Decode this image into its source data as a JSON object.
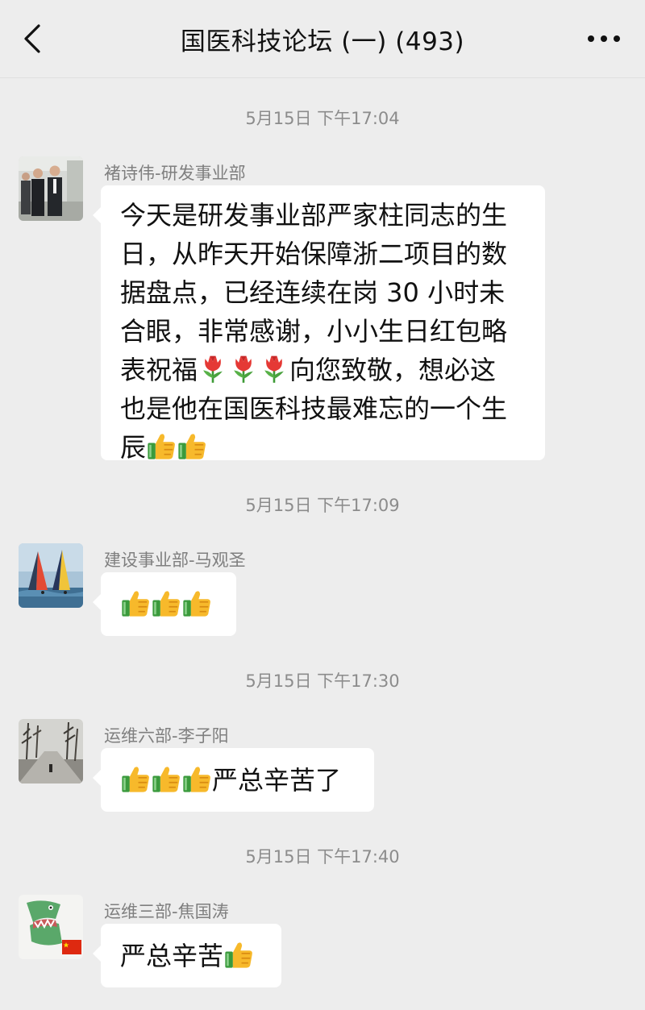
{
  "header": {
    "title": "国医科技论坛 (一) (493)"
  },
  "messages": [
    {
      "time": "5月15日 下午17:04",
      "sender": "褚诗伟-研发事业部",
      "text": "今天是研发事业部严家柱同志的生日，从昨天开始保障浙二项目的数据盘点，已经连续在岗 30 小时未合眼，非常感谢，小小生日红包略表祝福🌷🌷🌷向您致敬，想必这也是他在国医科技最难忘的一个生辰👍👍"
    },
    {
      "time": "5月15日 下午17:09",
      "sender": "建设事业部-马观圣",
      "text": "👍👍👍"
    },
    {
      "time": "5月15日 下午17:30",
      "sender": "运维六部-李子阳",
      "text": "👍👍👍严总辛苦了"
    },
    {
      "time": "5月15日 下午17:40",
      "sender": "运维三部-焦国涛",
      "text": "严总辛苦👍"
    }
  ],
  "m1_lines": [
    "今天是研发事业部严家柱同志的生",
    "日，从昨天开始保障浙二项目的数",
    "据盘点，已经连续在岗 30 小时未",
    "合眼，非常感谢，小小生日红包略",
    "表祝福",
    "向您致敬，想必这",
    "也是他在国医科技最难忘的一个生",
    "辰"
  ],
  "m3_suffix": "严总辛苦了",
  "m4_prefix": "严总辛苦",
  "icons": {
    "back": "chevron-left-icon",
    "more": "more-dots-icon",
    "thumbs": "thumbs-up-icon",
    "flower": "tulip-icon",
    "flag": "china-flag-icon"
  },
  "colors": {
    "background": "#ededed",
    "bubble": "#ffffff",
    "timestamp": "#8c8c8c",
    "sender": "#7f7f7f"
  }
}
